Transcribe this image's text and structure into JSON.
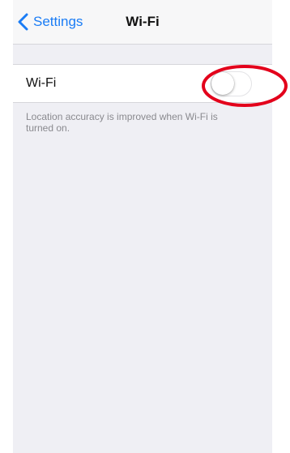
{
  "navbar": {
    "back_label": "Settings",
    "title": "Wi-Fi",
    "accent_color": "#1a7cf5"
  },
  "wifi_cell": {
    "label": "Wi-Fi",
    "toggle_state": "off"
  },
  "footnote": "Location accuracy is improved when Wi-Fi is turned on.",
  "annotation": {
    "shape": "ellipse",
    "color": "#e3001b"
  }
}
